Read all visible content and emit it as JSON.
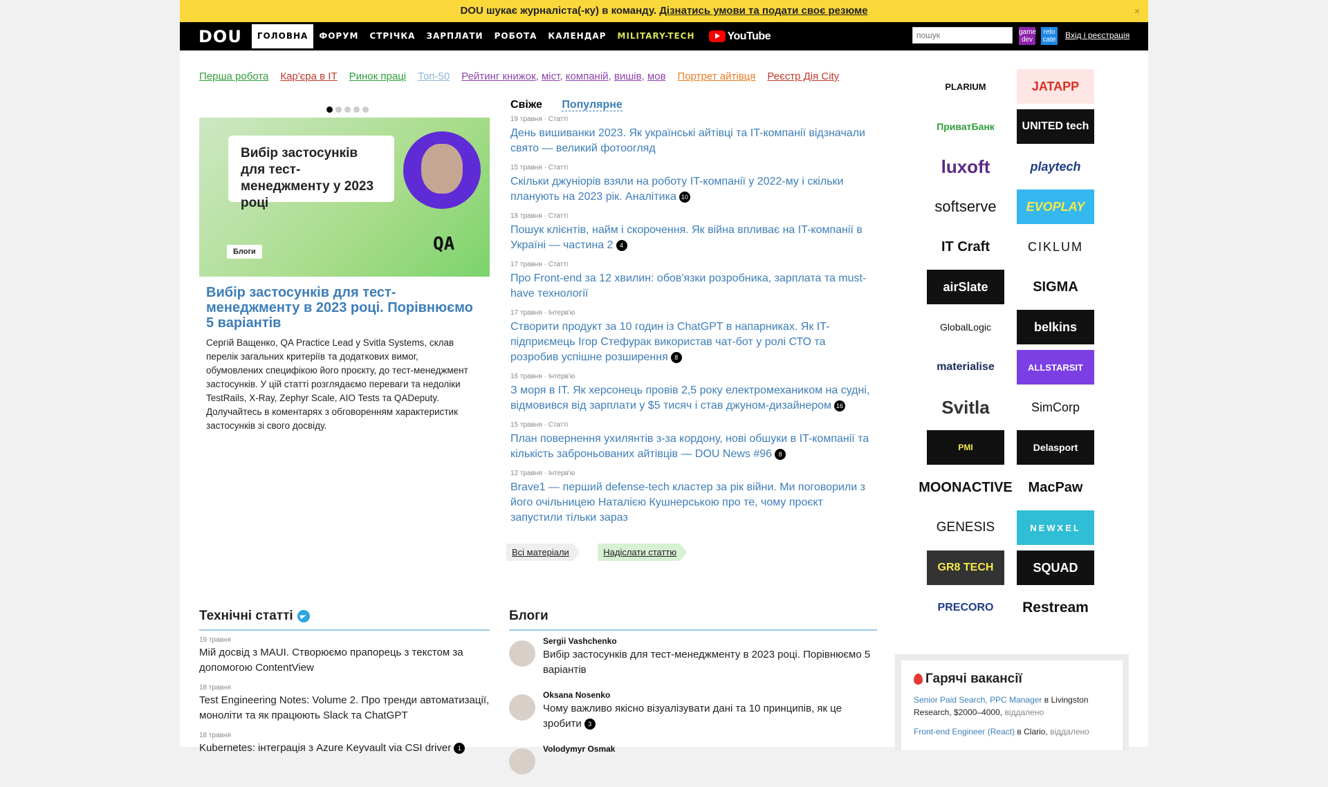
{
  "banner": {
    "text": "DOU шукає журналіста(-ку) в команду.",
    "link": "Дізнатись умови та подати своє резюме",
    "close": "×"
  },
  "logo": "DOU",
  "nav": [
    "ГОЛОВНА",
    "ФОРУМ",
    "СТРІЧКА",
    "ЗАРПЛАТИ",
    "РОБОТА",
    "КАЛЕНДАР",
    "MILITARY-TECH"
  ],
  "youtube": "YouTube",
  "search": {
    "placeholder": "пошук"
  },
  "badges": {
    "gamedev": "game dev",
    "relocate": "relo cate"
  },
  "login": "Вхід і реєстрація",
  "subnav": [
    {
      "label": "Перша робота",
      "color": "#2e9e3a"
    },
    {
      "label": "Кар'єра в IT",
      "color": "#c0392b"
    },
    {
      "label": "Ринок праці",
      "color": "#2e9e3a"
    },
    {
      "label": "Топ-50",
      "color": "#8fb4d6"
    },
    {
      "label": "Рейтинг книжок",
      "color": "#8e44ad"
    },
    {
      "label": "міст",
      "color": "#8e44ad"
    },
    {
      "label": "компаній",
      "color": "#8e44ad"
    },
    {
      "label": "вишів",
      "color": "#8e44ad"
    },
    {
      "label": "мов",
      "color": "#8e44ad"
    },
    {
      "label": "Портрет айтівця",
      "color": "#e67e22"
    },
    {
      "label": "Реєстр Дія City",
      "color": "#c0392b"
    }
  ],
  "featured": {
    "card": "Вибір застосунків для тест-менеджменту у 2023 році",
    "tag": "Блоги",
    "brand": "QA",
    "title": "Вибір застосунків для тест-менеджменту в 2023 році. Порівнюємо 5 варіантів",
    "text": "Сергій Ващенко, QA Practice Lead у Svitla Systems, склав перелік загальних критеріїв та додаткових вимог, обумовлених специфікою його проєкту, до тест-менеджмент застосунків. У цій статті розглядаємо переваги та недоліки TestRails, X-Ray, Zephyr Scale, AIO Tests та QADeputy. Долучайтесь в коментарях з обговоренням характеристик застосунків зі свого досвіду."
  },
  "tabs": {
    "fresh": "Свіже",
    "popular": "Популярне"
  },
  "news": [
    {
      "meta": "19 травня · Статті",
      "title": "День вишиванки 2023. Як українські айтівці та IT-компанії відзначали свято — великий фотоогляд",
      "comments": ""
    },
    {
      "meta": "15 травня · Статті",
      "title": "Скільки джуніорів взяли на роботу IT-компанії у 2022-му і скільки планують на 2023 рік. Аналітика",
      "comments": "10"
    },
    {
      "meta": "18 травня · Статті",
      "title": "Пошук клієнтів, найм і скорочення. Як війна впливає на IT-компанії в Україні — частина 2",
      "comments": "4"
    },
    {
      "meta": "17 травня · Статті",
      "title": "Про Front-end за 12 хвилин: обов'язки розробника, зарплата та must-have технології",
      "comments": ""
    },
    {
      "meta": "17 травня · Інтерв'ю",
      "title": "Створити продукт за 10 годин із ChatGPT в напарниках. Як IT-підприємець Ігор Стефурак використав чат-бот у ролі СТО та розробив успішне розширення",
      "comments": "8"
    },
    {
      "meta": "16 травня · Інтерв'ю",
      "title": "З моря в IT. Як херсонець провів 2,5 року електромехаником на судні, відмовився від зарплати у $5 тисяч і став джуном-дизайнером",
      "comments": "16"
    },
    {
      "meta": "15 травня · Статті",
      "title": "План повернення ухилянтів з-за кордону, нові обшуки в IT-компанії та кількість заброньованих айтівців — DOU News #96",
      "comments": "8"
    },
    {
      "meta": "12 травня · Інтерв'ю",
      "title": "Brave1 — перший defense-tech кластер за рік війни. Ми поговорили з його очільницею Наталією Кушнерською про те, чому проєкт запустили тільки зараз",
      "comments": ""
    }
  ],
  "actions": {
    "all": "Всі матеріали",
    "send": "Надіслати статтю"
  },
  "tech": {
    "heading": "Технічні статті",
    "items": [
      {
        "date": "19 травня",
        "title": "Мій досвід з MAUI. Створюємо прапорець з текстом за допомогою ContentView",
        "comments": ""
      },
      {
        "date": "18 травня",
        "title": "Test Engineering Notes: Volume 2. Про тренди автоматизації, моноліти та як працюють Slack та ChatGPT",
        "comments": ""
      },
      {
        "date": "18 травня",
        "title": "Kubernetes: інтеграція з Azure Keyvault via CSI driver",
        "comments": "1"
      }
    ]
  },
  "blogs": {
    "heading": "Блоги",
    "items": [
      {
        "author": "Sergii Vashchenko",
        "title": "Вибір застосунків для тест-менеджменту в 2023 році. Порівнюємо 5 варіантів",
        "comments": ""
      },
      {
        "author": "Oksana Nosenko",
        "title": "Чому важливо якісно візуалізувати дані та 10 принципів, як це зробити",
        "comments": "3"
      },
      {
        "author": "Volodymyr Osmak",
        "title": "",
        "comments": ""
      }
    ]
  },
  "logos": [
    "PLARIUM",
    "JATAPP",
    "ПриватБанк",
    "UNITED tech",
    "luxoft",
    "playtech",
    "softserve",
    "EVOPLAY",
    "IT Craft",
    "CIKLUM",
    "airSlate",
    "SIGMA",
    "GlobalLogic",
    "belkins",
    "materialise",
    "ALLSTARSIT",
    "Svitla",
    "SimCorp",
    "PMI",
    "Delasport",
    "MOONACTIVE",
    "MacPaw",
    "GENESIS",
    "NEWXEL",
    "GR8 TECH",
    "SQUAD",
    "PRECORO",
    "Restream"
  ],
  "jobs": {
    "heading": "Гарячі вакансії",
    "items": [
      {
        "title": "Senior Paid Search, PPC Manager",
        "company": "Livingston Research, $2000–4000",
        "remote": "віддалено"
      },
      {
        "title": "Front-end Engineer (React)",
        "company": "Clario",
        "remote": "віддалено"
      }
    ]
  }
}
